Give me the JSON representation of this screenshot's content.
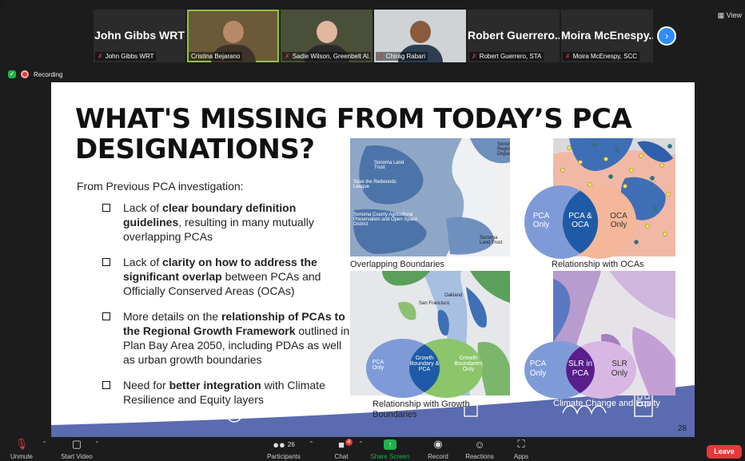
{
  "meeting": {
    "view_label": "View",
    "next_icon": "chevron-right-icon",
    "participants": [
      {
        "kind": "name",
        "display_name": "John Gibbs WRT",
        "label": "John Gibbs WRT",
        "muted": true
      },
      {
        "kind": "video",
        "label": "Cristina Bejarano",
        "muted": false,
        "active": true
      },
      {
        "kind": "video",
        "label": "Sadie Wilson, Greenbelt Al...",
        "muted": true
      },
      {
        "kind": "video",
        "label": "Chirag Rabari",
        "muted": true
      },
      {
        "kind": "name",
        "display_name": "Robert Guerrero...",
        "label": "Robert Guerrero, STA",
        "muted": true
      },
      {
        "kind": "name",
        "display_name": "Moira McEnespy...",
        "label": "Moira McEnespy, SCC",
        "muted": true
      }
    ],
    "recording_label": "Recording"
  },
  "slide": {
    "title": "WHAT'S MISSING FROM TODAY’S PCA DESIGNATIONS?",
    "intro": "From Previous PCA investigation:",
    "bullets": [
      {
        "pre": "Lack of ",
        "bold": "clear boundary definition guidelines",
        "post": ", resulting in many mutually overlapping PCAs"
      },
      {
        "pre": "Lack of ",
        "bold": "clarity on how to address the significant overlap",
        "post": " between PCAs and Officially Conserved Areas (OCAs)"
      },
      {
        "pre": "More details on the ",
        "bold": "relationship of PCAs to the Regional Growth Framework",
        "post": " outlined in Plan Bay Area 2050, including PDAs as well as urban growth boundaries"
      },
      {
        "pre": "Need for ",
        "bold": "better integration",
        "post": " with Climate Resilience and Equity layers"
      }
    ],
    "panels": {
      "overlap": {
        "caption": "Overlapping Boundaries",
        "map_labels": [
          "Sonoma Land Trust",
          "Save the Redwoods League",
          "Sonoma County Agricultural Preservation and Open Space District",
          "Sonoma Land Trust",
          "Sonor Regio Depar"
        ]
      },
      "ocas": {
        "caption": "Relationship with OCAs",
        "venn": [
          "PCA Only",
          "PCA & OCA",
          "OCA Only"
        ]
      },
      "growth": {
        "caption": "Relationship with Growth Boundaries",
        "venn": [
          "PCA Only",
          "Growth Boundary & PCA",
          "Growth Boundaries Only"
        ],
        "map_labels": [
          "San Francisco",
          "Oakland"
        ]
      },
      "climate": {
        "caption": "Climate Change and Equity",
        "venn": [
          "PCA Only",
          "SLR in PCA",
          "SLR Only"
        ]
      }
    },
    "page_number": "28",
    "colors": {
      "venn_blue": "#7e9bd8",
      "venn_dark_blue": "#1f5aa6",
      "venn_peach": "#f4b79a",
      "venn_green": "#8cc56a",
      "venn_purple": "#5a1e8c",
      "venn_lilac": "#d8b7e3",
      "band": "#5a6bb0"
    }
  },
  "toolbar": {
    "unmute": "Unmute",
    "start_video": "Start Video",
    "participants": "Participants",
    "participants_count": "26",
    "chat": "Chat",
    "chat_badge": "4",
    "share_screen": "Share Screen",
    "record": "Record",
    "reactions": "Reactions",
    "apps": "Apps",
    "leave": "Leave"
  }
}
